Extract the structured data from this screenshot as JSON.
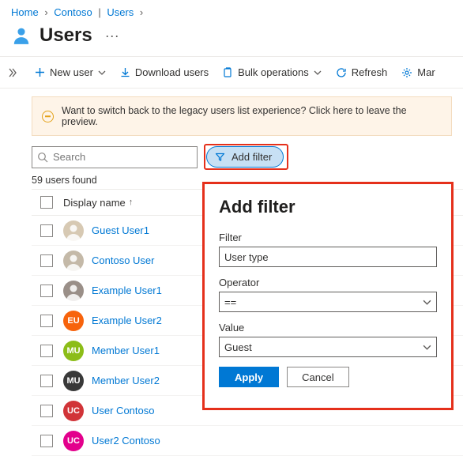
{
  "breadcrumb": {
    "home": "Home",
    "org": "Contoso",
    "section": "Users"
  },
  "page_title": "Users",
  "toolbar": {
    "new_user": "New user",
    "download_users": "Download users",
    "bulk_ops": "Bulk operations",
    "refresh": "Refresh",
    "manage": "Mar"
  },
  "banner": {
    "text": "Want to switch back to the legacy users list experience? Click here to leave the preview."
  },
  "search": {
    "placeholder": "Search"
  },
  "add_filter_label": "Add filter",
  "count_text": "59 users found",
  "columns": {
    "displayname": "Display name"
  },
  "users": [
    {
      "name": "Guest User1",
      "initials": "",
      "avatar_bg": "#d7c9b3",
      "avatar_type": "photo1"
    },
    {
      "name": "Contoso User",
      "initials": "",
      "avatar_bg": "#c4b9a8",
      "avatar_type": "photo2"
    },
    {
      "name": "Example User1",
      "initials": "",
      "avatar_bg": "#9a8f88",
      "avatar_type": "photo3"
    },
    {
      "name": "Example User2",
      "initials": "EU",
      "avatar_bg": "#f7630c",
      "avatar_type": "initials"
    },
    {
      "name": "Member User1",
      "initials": "MU",
      "avatar_bg": "#8cbd18",
      "avatar_type": "initials"
    },
    {
      "name": "Member User2",
      "initials": "MU",
      "avatar_bg": "#393939",
      "avatar_type": "initials"
    },
    {
      "name": "User Contoso",
      "initials": "UC",
      "avatar_bg": "#d13438",
      "avatar_type": "initials"
    },
    {
      "name": "User2 Contoso",
      "initials": "UC",
      "avatar_bg": "#e3008c",
      "avatar_type": "initials"
    }
  ],
  "filter_panel": {
    "title": "Add filter",
    "filter_label": "Filter",
    "filter_value": "User type",
    "operator_label": "Operator",
    "operator_value": "==",
    "value_label": "Value",
    "value_value": "Guest",
    "apply": "Apply",
    "cancel": "Cancel"
  }
}
